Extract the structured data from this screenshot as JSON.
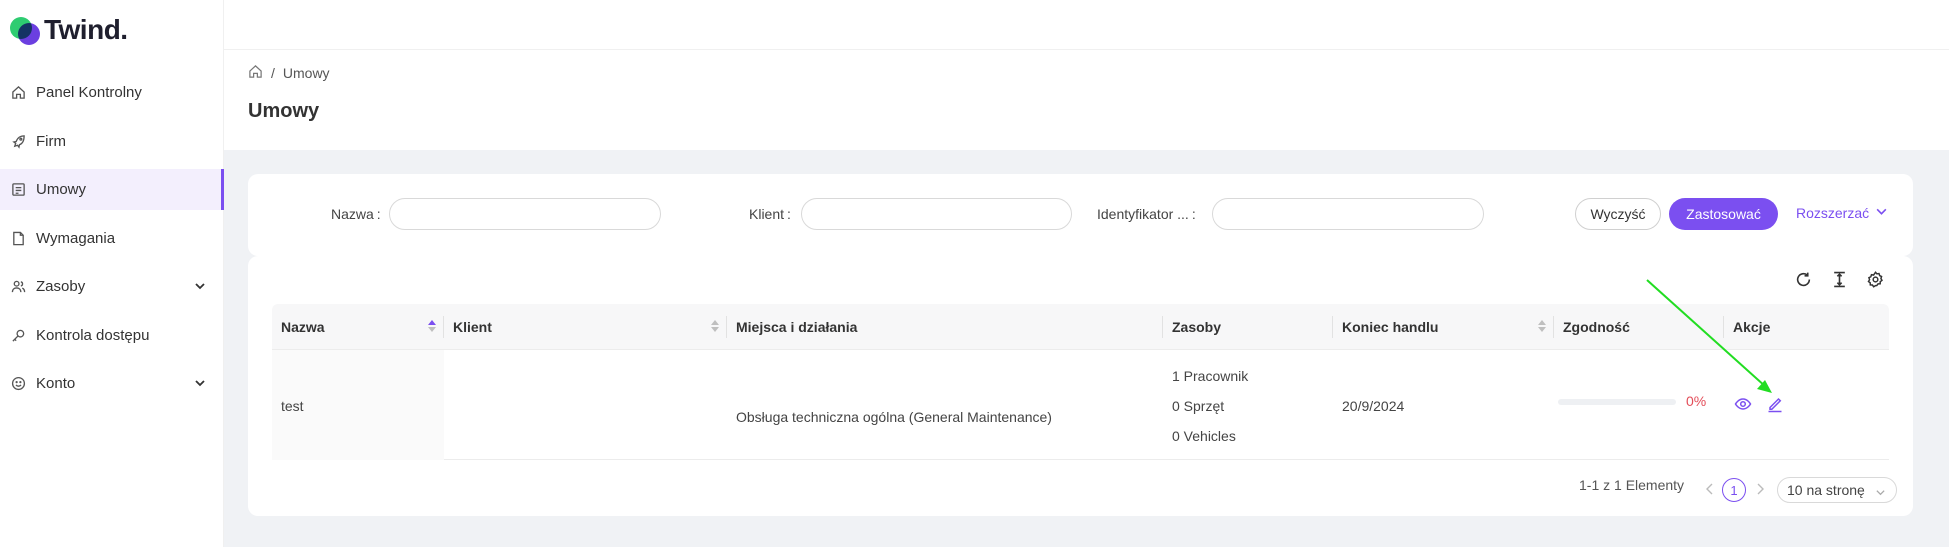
{
  "brand": {
    "name": "Twind."
  },
  "sidebar": {
    "items": [
      {
        "label": "Panel Kontrolny",
        "icon": "home-icon"
      },
      {
        "label": "Firm",
        "icon": "rocket-icon"
      },
      {
        "label": "Umowy",
        "icon": "contract-icon",
        "active": true
      },
      {
        "label": "Wymagania",
        "icon": "document-icon"
      },
      {
        "label": "Zasoby",
        "icon": "users-icon",
        "expandable": true
      },
      {
        "label": "Kontrola dostępu",
        "icon": "key-icon"
      },
      {
        "label": "Konto",
        "icon": "smile-icon",
        "expandable": true
      }
    ]
  },
  "breadcrumb": {
    "separator": "/",
    "current": "Umowy"
  },
  "page": {
    "title": "Umowy"
  },
  "filters": {
    "name_label": "Nazwa",
    "client_label": "Klient",
    "id_label": "Identyfikator ...",
    "colon": ":",
    "name_value": "",
    "client_value": "",
    "id_value": "",
    "clear_label": "Wyczyść",
    "apply_label": "Zastosować",
    "expand_label": "Rozszerzać"
  },
  "table": {
    "columns": [
      "Nazwa",
      "Klient",
      "Miejsca i działania",
      "Zasoby",
      "Koniec handlu",
      "Zgodność",
      "Akcje"
    ],
    "rows": [
      {
        "name": "test",
        "client": "",
        "places": "Obsługa techniczna ogólna (General Maintenance)",
        "resources": [
          "1 Pracownik",
          "0 Sprzęt",
          "0 Vehicles"
        ],
        "end_date": "20/9/2024",
        "compliance": "0%",
        "compliance_value": 0
      }
    ]
  },
  "pagination": {
    "summary": "1-1 z 1 Elementy",
    "current_page": "1",
    "page_size": "10 na stronę"
  },
  "colors": {
    "accent": "#7b4ff0",
    "logo_green": "#2ecc71",
    "danger": "#e34d59",
    "annotation_arrow": "#22dd22"
  }
}
